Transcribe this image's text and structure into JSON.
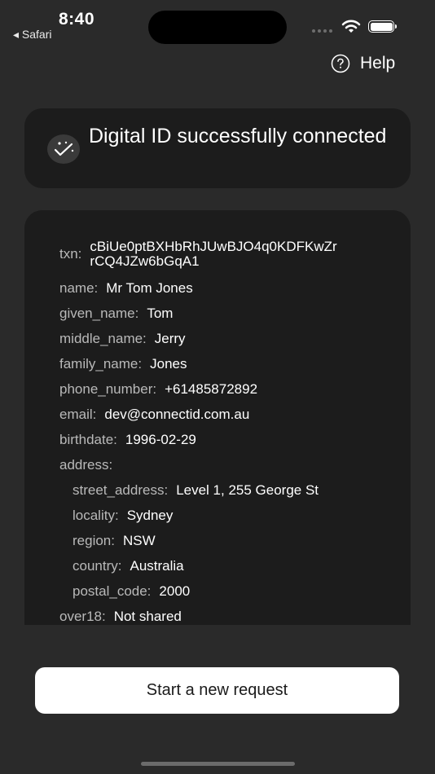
{
  "status_bar": {
    "time": "8:40",
    "back_app": "◂ Safari"
  },
  "header": {
    "help_label": "Help"
  },
  "success": {
    "message": "Digital ID successfully connected"
  },
  "claims": [
    {
      "key": "txn:",
      "value": "cBiUe0ptBXHbRhJUwBJO4q0KDFKwZr rCQ4JZw6bGqA1"
    },
    {
      "key": "name:",
      "value": "Mr Tom Jones"
    },
    {
      "key": "given_name:",
      "value": "Tom"
    },
    {
      "key": "middle_name:",
      "value": "Jerry"
    },
    {
      "key": "family_name:",
      "value": "Jones"
    },
    {
      "key": "phone_number:",
      "value": "+61485872892"
    },
    {
      "key": "email:",
      "value": "dev@connectid.com.au"
    },
    {
      "key": "birthdate:",
      "value": "1996-02-29"
    },
    {
      "key": "address:",
      "value": ""
    },
    {
      "key": "street_address:",
      "value": "Level 1, 255 George St"
    },
    {
      "key": "locality:",
      "value": "Sydney"
    },
    {
      "key": "region:",
      "value": "NSW"
    },
    {
      "key": "country:",
      "value": "Australia"
    },
    {
      "key": "postal_code:",
      "value": "2000"
    },
    {
      "key": "over18:",
      "value": "Not shared"
    }
  ],
  "actions": {
    "primary_label": "Start a new request"
  },
  "icons": {
    "help": "question-circle-icon",
    "success": "sparkle-check-icon"
  }
}
